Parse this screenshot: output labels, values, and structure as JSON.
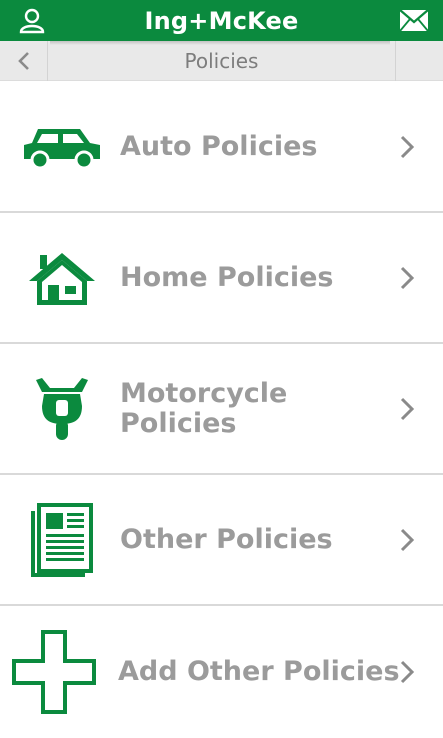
{
  "header": {
    "title": "Ing+McKee",
    "left_icon": "profile-icon",
    "right_icon": "mail-icon",
    "brand_color": "#0b8a3e"
  },
  "subheader": {
    "title": "Policies",
    "back_icon": "chevron-left-icon"
  },
  "policies": [
    {
      "label": "Auto Policies",
      "icon": "car-icon"
    },
    {
      "label": "Home Policies",
      "icon": "house-icon"
    },
    {
      "label": "Motorcycle Policies",
      "icon": "motorcycle-icon"
    },
    {
      "label": "Other Policies",
      "icon": "document-icon"
    },
    {
      "label": "Add Other Policies",
      "icon": "plus-icon"
    }
  ]
}
